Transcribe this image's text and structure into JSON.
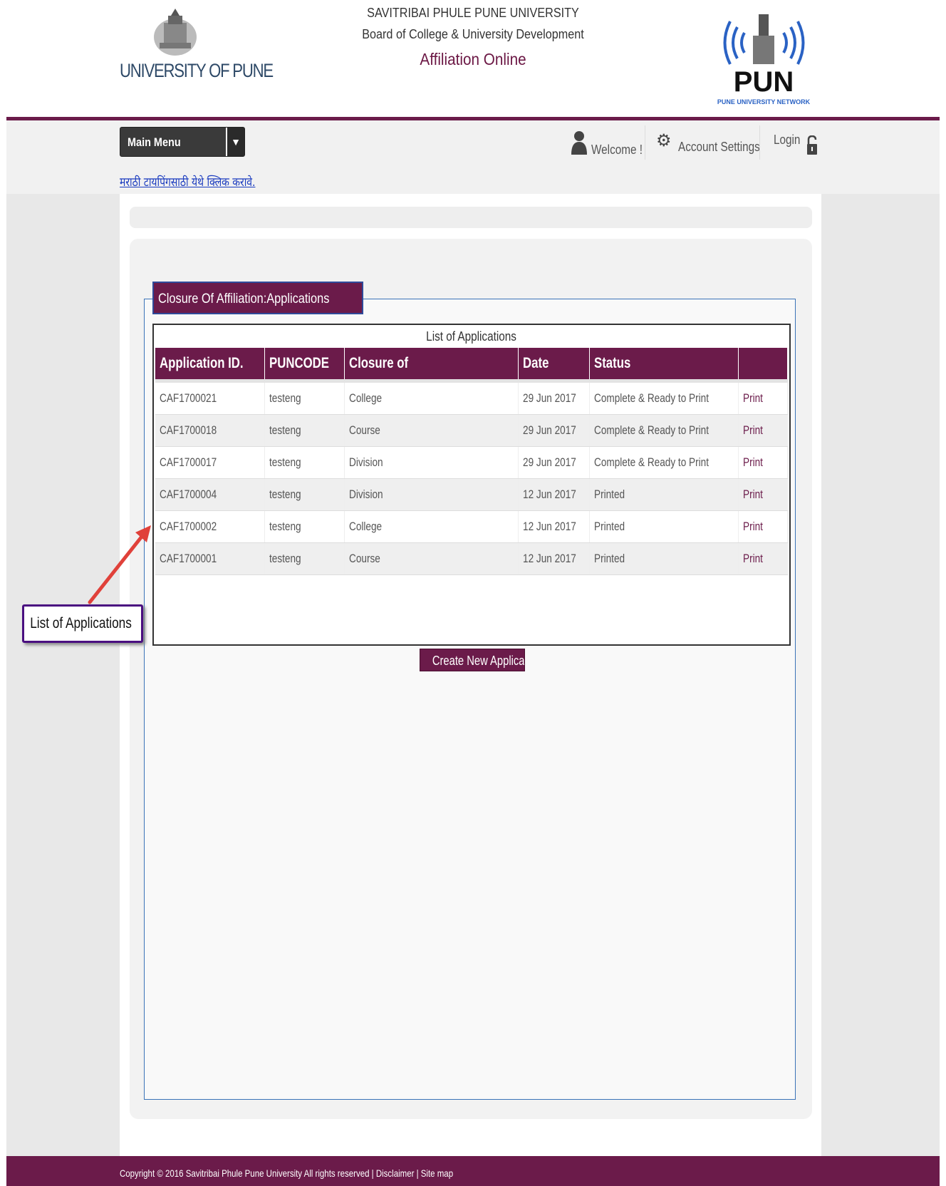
{
  "header": {
    "logo_text": "UNIVERSITY OF PUNE",
    "university_name": "SAVITRIBAI PHULE PUNE UNIVERSITY",
    "board_name": "Board of College & University Development",
    "app_title": "Affiliation Online",
    "network_logo_text": "PUN",
    "network_logo_caption": "PUNE UNIVERSITY NETWORK"
  },
  "nav": {
    "main_menu_label": "Main Menu",
    "main_menu_caret": "▼",
    "welcome_label": "Welcome !",
    "account_settings_label": "Account Settings",
    "login_label": "Login",
    "marathi_typing_link": "मराठी टायपिंगसाठी येथे क्लिक करावे."
  },
  "section": {
    "legend": "Closure Of Affiliation:Applications",
    "table_caption": "List of Applications",
    "columns": [
      "Application ID.",
      "PUNCODE",
      "Closure of",
      "Date",
      "Status",
      ""
    ],
    "rows": [
      {
        "id": "CAF1700021",
        "puncode": "testeng",
        "closure_of": "College",
        "date": "29 Jun 2017",
        "status": "Complete & Ready to Print",
        "action": "Print"
      },
      {
        "id": "CAF1700018",
        "puncode": "testeng",
        "closure_of": "Course",
        "date": "29 Jun 2017",
        "status": "Complete & Ready to Print",
        "action": "Print"
      },
      {
        "id": "CAF1700017",
        "puncode": "testeng",
        "closure_of": "Division",
        "date": "29 Jun 2017",
        "status": "Complete & Ready to Print",
        "action": "Print"
      },
      {
        "id": "CAF1700004",
        "puncode": "testeng",
        "closure_of": "Division",
        "date": "12 Jun 2017",
        "status": "Printed",
        "action": "Print"
      },
      {
        "id": "CAF1700002",
        "puncode": "testeng",
        "closure_of": "College",
        "date": "12 Jun 2017",
        "status": "Printed",
        "action": "Print"
      },
      {
        "id": "CAF1700001",
        "puncode": "testeng",
        "closure_of": "Course",
        "date": "12 Jun 2017",
        "status": "Printed",
        "action": "Print"
      }
    ],
    "create_button": "Create New Application"
  },
  "annotation": {
    "callout_text": "List of Applications",
    "arrow_color": "#e0413a"
  },
  "footer": {
    "text": "Copyright © 2016 Savitribai Phule Pune University All rights reserved | Disclaimer | Site map"
  },
  "colors": {
    "brand": "#6b1b4a",
    "link": "#1a3bbf",
    "fieldset_border": "#3a73b8"
  }
}
